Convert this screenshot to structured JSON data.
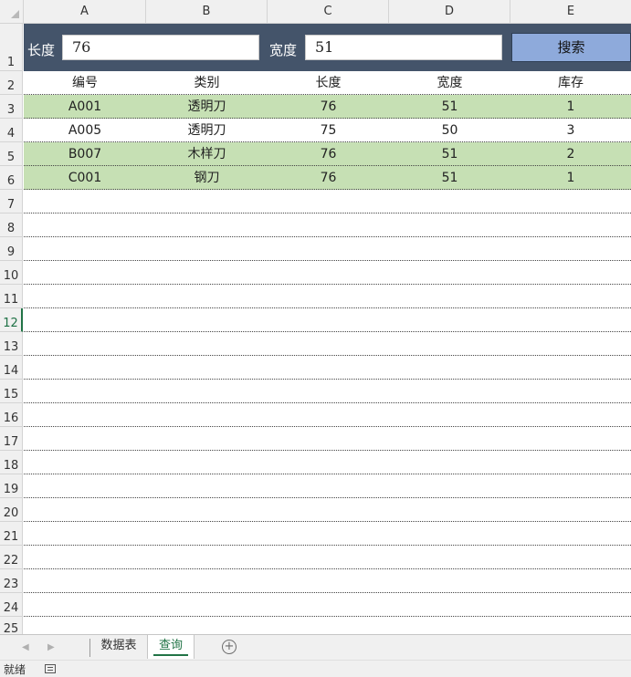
{
  "columns": [
    "A",
    "B",
    "C",
    "D",
    "E"
  ],
  "search": {
    "length_label": "长度",
    "length_value": "76",
    "width_label": "宽度",
    "width_value": "51",
    "button_label": "搜索"
  },
  "table": {
    "headers": [
      "编号",
      "类别",
      "长度",
      "宽度",
      "库存"
    ],
    "rows": [
      [
        "A001",
        "透明刀",
        "76",
        "51",
        "1"
      ],
      [
        "A005",
        "透明刀",
        "75",
        "50",
        "3"
      ],
      [
        "B007",
        "木样刀",
        "76",
        "51",
        "2"
      ],
      [
        "C001",
        "钢刀",
        "76",
        "51",
        "1"
      ]
    ],
    "highlighted_rows": [
      0,
      2,
      3
    ],
    "highlight_color": "#c6e0b4"
  },
  "row_numbers": [
    "1",
    "2",
    "3",
    "4",
    "5",
    "6",
    "7",
    "8",
    "9",
    "10",
    "11",
    "12",
    "13",
    "14",
    "15",
    "16",
    "17",
    "18",
    "19",
    "20",
    "21",
    "22",
    "23",
    "24",
    "25"
  ],
  "active_row": "12",
  "sheets": {
    "tabs": [
      "数据表",
      "查询"
    ],
    "active": "查询",
    "add_icon": "plus-circle-icon"
  },
  "status": {
    "text": "就绪",
    "macro_icon": "record-macro-icon"
  },
  "colors": {
    "banner": "#44546a",
    "button": "#8eaadb",
    "accent": "#217346"
  }
}
